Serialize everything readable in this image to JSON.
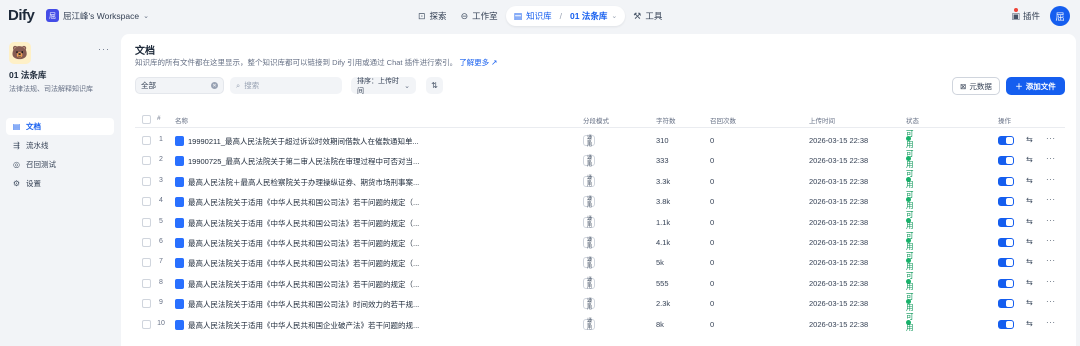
{
  "topbar": {
    "logo": "Dify",
    "workspace_badge": "屈",
    "workspace_name": "屈江峰's Workspace",
    "nav": {
      "explore": "探索",
      "studio": "工作室",
      "knowledge": "知识库",
      "current_kb": "01 法条库",
      "tools": "工具"
    },
    "plugins": "插件",
    "avatar": "屈"
  },
  "sidebar": {
    "kb_name": "01 法条库",
    "kb_desc": "法律法规、司法解释知识库",
    "menu": [
      {
        "label": "文档",
        "icon": "document-icon"
      },
      {
        "label": "流水线",
        "icon": "pipeline-icon"
      },
      {
        "label": "召回测试",
        "icon": "target-icon"
      },
      {
        "label": "设置",
        "icon": "settings-icon"
      }
    ]
  },
  "main": {
    "title": "文档",
    "subtitle": "知识库的所有文件都在这里显示，整个知识库都可以链接到 Dify 引用或通过 Chat 插件进行索引。",
    "learn_more": "了解更多",
    "filter_value": "全部",
    "search_placeholder": "搜索",
    "sort_label": "排序：上传时间",
    "metadata_button": "元数据",
    "add_file_button": "添加文件"
  },
  "table": {
    "headers": {
      "num": "#",
      "name": "名称",
      "mode": "分段模式",
      "chars": "字符数",
      "hits": "召回次数",
      "date": "上传时间",
      "status": "状态",
      "action": "操作"
    },
    "rows": [
      {
        "num": "1",
        "name": "19990211_最高人民法院关于超过诉讼时效期间借款人在催款通知单...",
        "mode": "通用",
        "chars": "310",
        "hits": "0",
        "date": "2026-03-15 22:38",
        "status": "可用"
      },
      {
        "num": "2",
        "name": "19900725_最高人民法院关于第二审人民法院在审理过程中可否对当...",
        "mode": "通用",
        "chars": "333",
        "hits": "0",
        "date": "2026-03-15 22:38",
        "status": "可用"
      },
      {
        "num": "3",
        "name": "最高人民法院＋最高人民检察院关于办理操纵证券、期货市场刑事案...",
        "mode": "通用",
        "chars": "3.3k",
        "hits": "0",
        "date": "2026-03-15 22:38",
        "status": "可用"
      },
      {
        "num": "4",
        "name": "最高人民法院关于适用《中华人民共和国公司法》若干问题的规定（...",
        "mode": "通用",
        "chars": "3.8k",
        "hits": "0",
        "date": "2026-03-15 22:38",
        "status": "可用"
      },
      {
        "num": "5",
        "name": "最高人民法院关于适用《中华人民共和国公司法》若干问题的规定（...",
        "mode": "通用",
        "chars": "1.1k",
        "hits": "0",
        "date": "2026-03-15 22:38",
        "status": "可用"
      },
      {
        "num": "6",
        "name": "最高人民法院关于适用《中华人民共和国公司法》若干问题的规定（...",
        "mode": "通用",
        "chars": "4.1k",
        "hits": "0",
        "date": "2026-03-15 22:38",
        "status": "可用"
      },
      {
        "num": "7",
        "name": "最高人民法院关于适用《中华人民共和国公司法》若干问题的规定（...",
        "mode": "通用",
        "chars": "5k",
        "hits": "0",
        "date": "2026-03-15 22:38",
        "status": "可用"
      },
      {
        "num": "8",
        "name": "最高人民法院关于适用《中华人民共和国公司法》若干问题的规定（...",
        "mode": "通用",
        "chars": "555",
        "hits": "0",
        "date": "2026-03-15 22:38",
        "status": "可用"
      },
      {
        "num": "9",
        "name": "最高人民法院关于适用《中华人民共和国公司法》时间效力的若干规...",
        "mode": "通用",
        "chars": "2.3k",
        "hits": "0",
        "date": "2026-03-15 22:38",
        "status": "可用"
      },
      {
        "num": "10",
        "name": "最高人民法院关于适用《中华人民共和国企业破产法》若干问题的规...",
        "mode": "通用",
        "chars": "8k",
        "hits": "0",
        "date": "2026-03-15 22:38",
        "status": "可用"
      }
    ]
  },
  "colors": {
    "accent": "#155eef",
    "status_ok": "#17b26a"
  }
}
